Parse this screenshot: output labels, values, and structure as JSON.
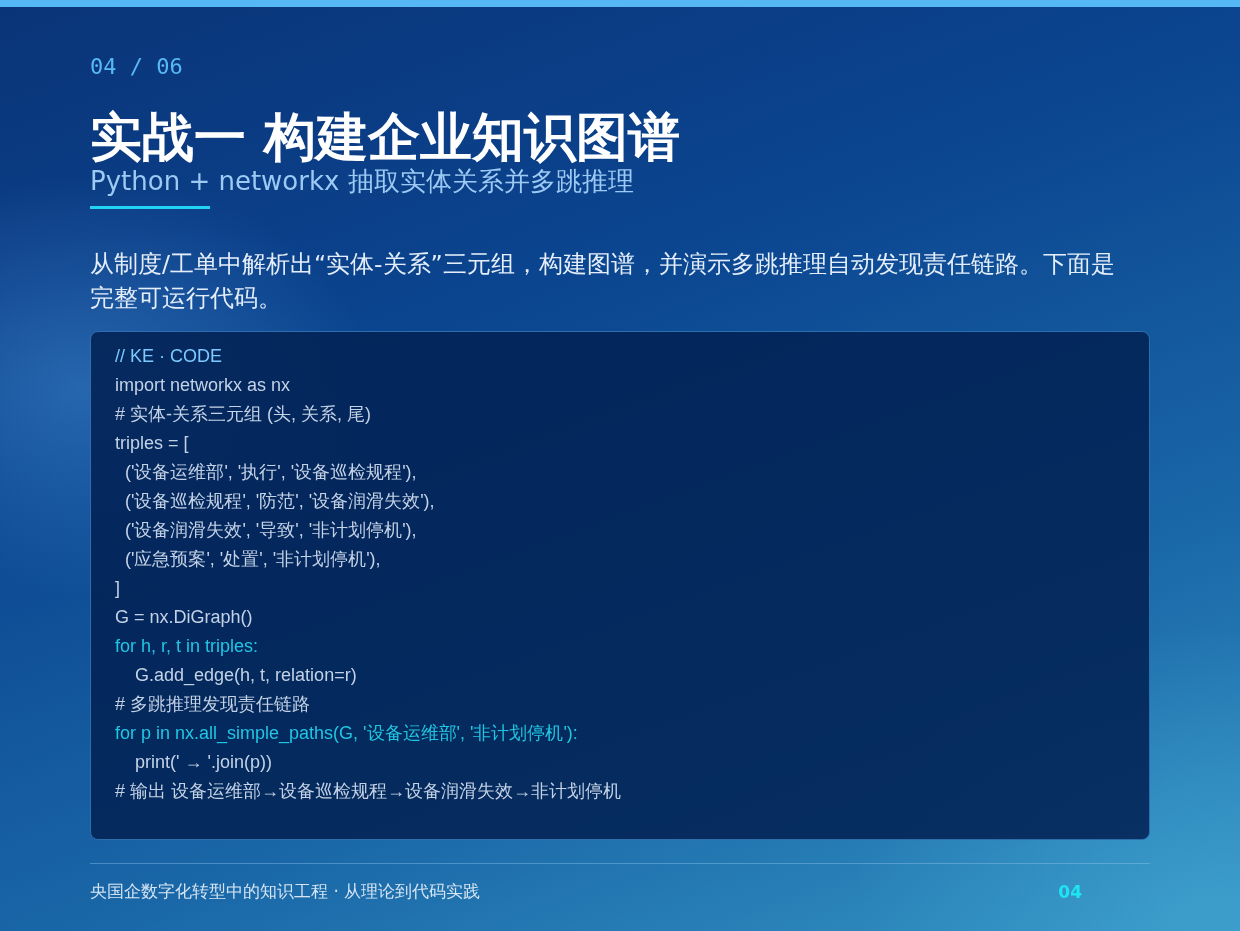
{
  "slide": {
    "counter": "04 / 06",
    "title": "实战一 构建企业知识图谱",
    "subtitle": "Python + networkx 抽取实体关系并多跳推理"
  },
  "intro": "从制度/工单中解析出“实体-关系”三元组，构建图谱，并演示多跳推理自动发现责任链路。下面是完整可运行代码。",
  "code_block": {
    "lines": [
      {
        "kind": "label",
        "text": "// KE · CODE"
      },
      {
        "kind": "plain",
        "text": "import networkx as nx"
      },
      {
        "kind": "plain",
        "text": "# 实体-关系三元组 (头, 关系, 尾)"
      },
      {
        "kind": "plain",
        "text": "triples = ["
      },
      {
        "kind": "plain",
        "text": "  ('设备运维部', '执行', '设备巡检规程'),"
      },
      {
        "kind": "plain",
        "text": "  ('设备巡检规程', '防范', '设备润滑失效'),"
      },
      {
        "kind": "plain",
        "text": "  ('设备润滑失效', '导致', '非计划停机'),"
      },
      {
        "kind": "plain",
        "text": "  ('应急预案', '处置', '非计划停机'),"
      },
      {
        "kind": "plain",
        "text": "]"
      },
      {
        "kind": "plain",
        "text": "G = nx.DiGraph()"
      },
      {
        "kind": "loop",
        "text": "for h, r, t in triples:"
      },
      {
        "kind": "plain",
        "text": "    G.add_edge(h, t, relation=r)"
      },
      {
        "kind": "plain",
        "text": "# 多跳推理发现责任链路"
      },
      {
        "kind": "loop",
        "text": "for p in nx.all_simple_paths(G, '设备运维部', '非计划停机'):"
      },
      {
        "kind": "plain",
        "text": "    print(' → '.join(p))"
      },
      {
        "kind": "plain",
        "text": "# 输出 设备运维部→设备巡检规程→设备润滑失效→非计划停机"
      }
    ]
  },
  "footer": {
    "caption": "央国企数字化转型中的知识工程 · 从理论到代码实践",
    "page": "04"
  }
}
